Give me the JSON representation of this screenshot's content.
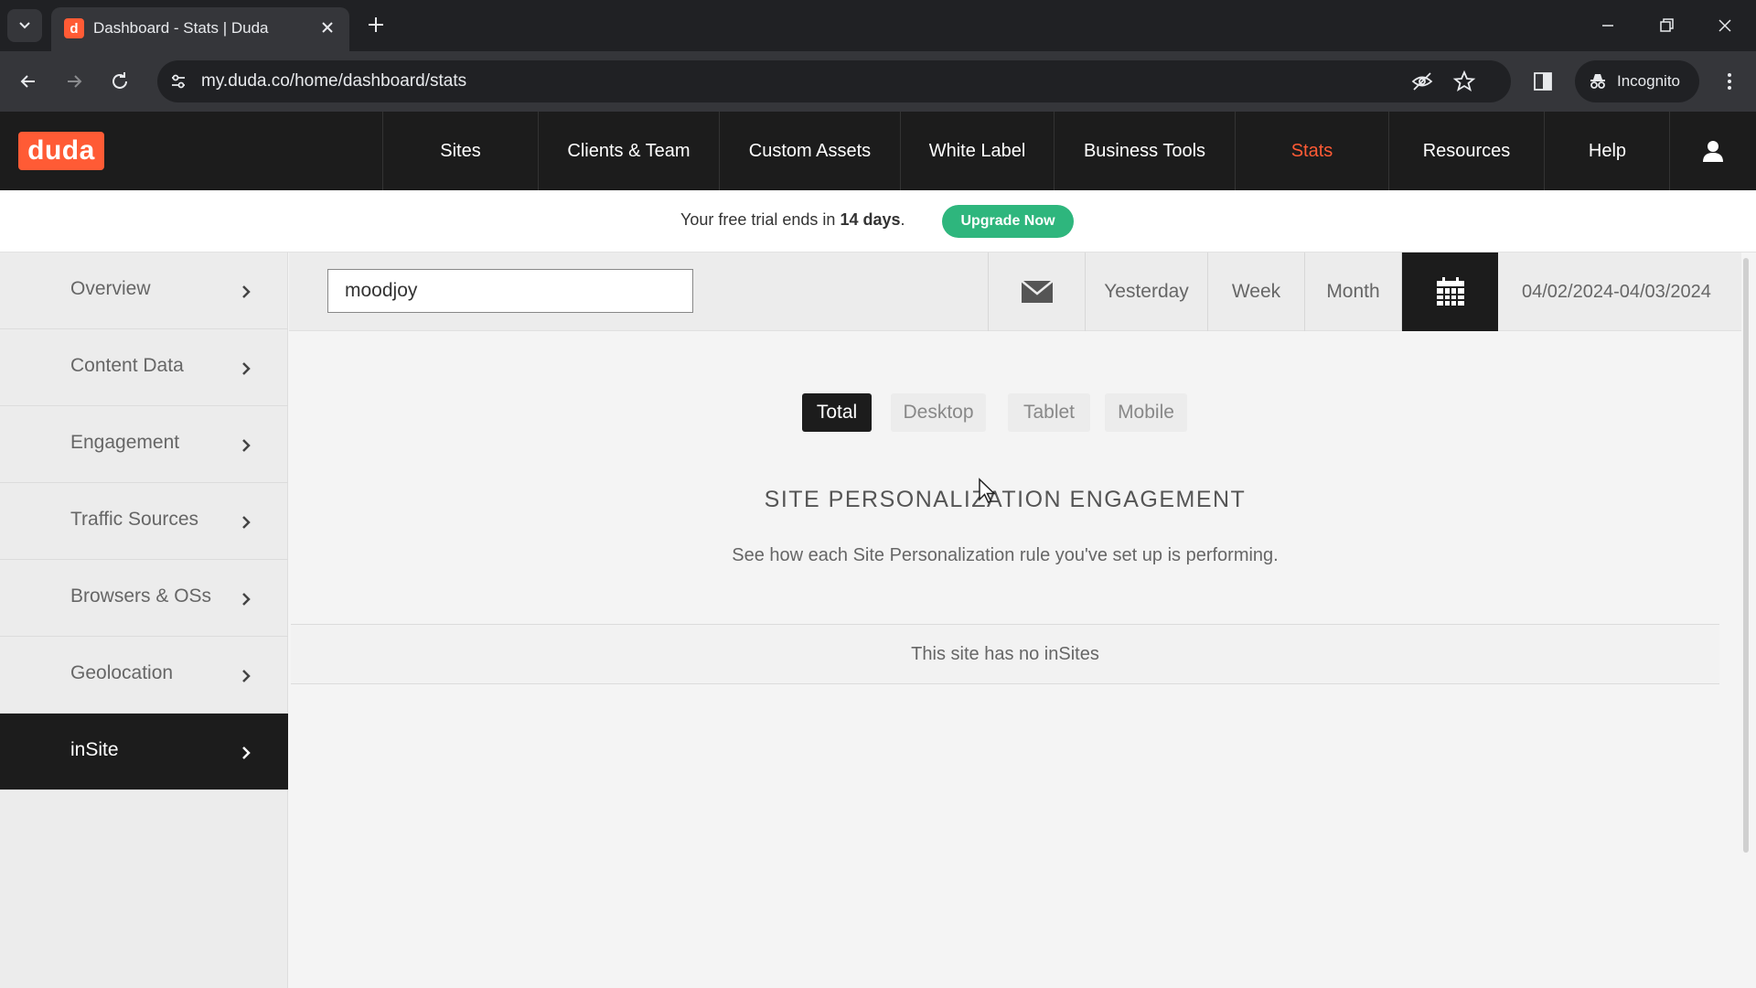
{
  "browser": {
    "tab_title": "Dashboard - Stats | Duda",
    "favicon_letter": "d",
    "url": "my.duda.co/home/dashboard/stats",
    "incognito_label": "Incognito"
  },
  "app": {
    "logo": "duda",
    "brand_color": "#ff5b35",
    "nav": [
      {
        "label": "Sites"
      },
      {
        "label": "Clients & Team"
      },
      {
        "label": "Custom Assets"
      },
      {
        "label": "White Label"
      },
      {
        "label": "Business Tools"
      },
      {
        "label": "Stats",
        "active": true
      },
      {
        "label": "Resources"
      },
      {
        "label": "Help"
      }
    ]
  },
  "trial": {
    "text_prefix": "Your free trial ends in ",
    "days": "14 days",
    "text_suffix": ".",
    "button": "Upgrade Now",
    "button_color": "#2eb67d"
  },
  "sidebar": {
    "items": [
      {
        "label": "Overview"
      },
      {
        "label": "Content Data"
      },
      {
        "label": "Engagement"
      },
      {
        "label": "Traffic Sources"
      },
      {
        "label": "Browsers & OSs"
      },
      {
        "label": "Geolocation"
      },
      {
        "label": "inSite",
        "active": true
      }
    ]
  },
  "toolbar": {
    "site_value": "moodjoy",
    "ranges": [
      "Yesterday",
      "Week",
      "Month"
    ],
    "date_range": "04/02/2024-04/03/2024"
  },
  "main": {
    "device_tabs": [
      {
        "label": "Total",
        "active": true
      },
      {
        "label": "Desktop"
      },
      {
        "label": "Tablet"
      },
      {
        "label": "Mobile"
      }
    ],
    "title": "SITE PERSONALIZATION ENGAGEMENT",
    "subtitle": "See how each Site Personalization rule you've set up is performing.",
    "empty_message": "This site has no inSites"
  }
}
